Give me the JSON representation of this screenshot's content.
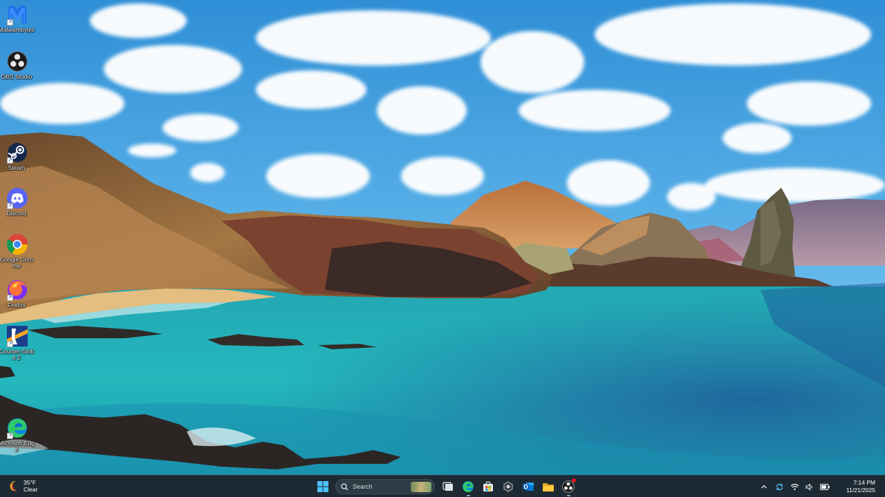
{
  "desktop": {
    "icons": [
      {
        "label": "Malwarebytes",
        "icon": "malwarebytes-icon",
        "shortcut": true
      },
      {
        "label": "OBS Studio",
        "icon": "obs-studio-icon",
        "shortcut": false
      },
      {
        "label": "Steam",
        "icon": "steam-icon",
        "shortcut": true
      },
      {
        "label": "Discord",
        "icon": "discord-icon",
        "shortcut": true
      },
      {
        "label": "Google Chrome",
        "icon": "chrome-icon",
        "shortcut": false
      },
      {
        "label": "Firefox",
        "icon": "firefox-icon",
        "shortcut": true
      },
      {
        "label": "Counter-Strike 2",
        "icon": "counter-strike-icon",
        "shortcut": true
      },
      {
        "label": "Microsoft Edge",
        "icon": "edge-icon",
        "shortcut": true
      }
    ],
    "wallpaper": "beach-landscape-wallpaper"
  },
  "taskbar": {
    "weather": {
      "temp": "35°F",
      "condition": "Clear",
      "icon": "weather-moon-icon"
    },
    "start_icon": "windows-start-icon",
    "search": {
      "placeholder": "Search",
      "icon": "search-icon"
    },
    "pinned": [
      {
        "name": "task-view",
        "icon": "task-view-icon"
      },
      {
        "name": "edge",
        "icon": "edge-icon",
        "running": true
      },
      {
        "name": "microsoft-store",
        "icon": "store-icon"
      },
      {
        "name": "app",
        "icon": "app-icon"
      },
      {
        "name": "outlook",
        "icon": "outlook-icon"
      },
      {
        "name": "file-explorer",
        "icon": "folder-icon"
      },
      {
        "name": "obs-studio",
        "icon": "obs-studio-icon",
        "running": true
      }
    ],
    "tray": {
      "icons": [
        "chevron-up-icon",
        "sync-icon",
        "wifi-icon",
        "volume-icon",
        "battery-icon"
      ],
      "time": "7:14 PM",
      "date": "11/21/2025"
    },
    "colors": {
      "bar": "#1d2a33",
      "accent": "#0078d4"
    }
  }
}
